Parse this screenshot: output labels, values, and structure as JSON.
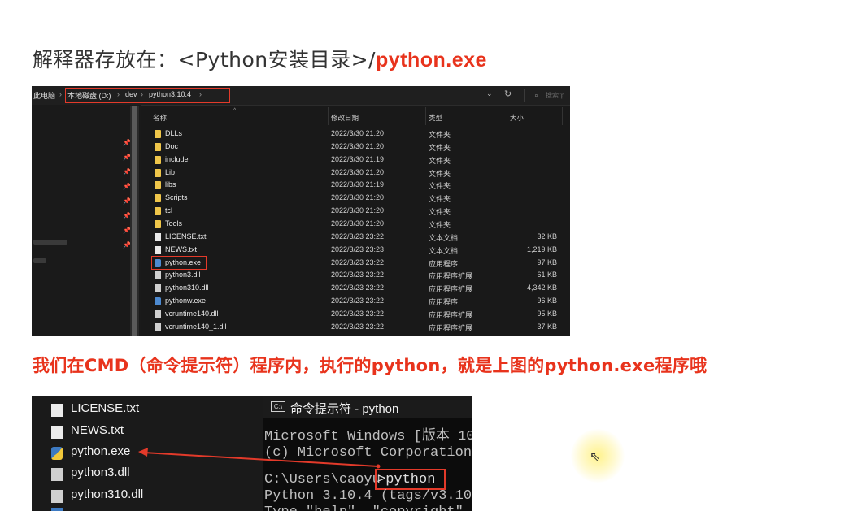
{
  "heading": {
    "prefix": "解释器存放在：<Python安装目录>/",
    "highlight": "python.exe"
  },
  "explorer": {
    "address": {
      "this_pc": "此电脑",
      "drive": "本地磁盘 (D:)",
      "folder1": "dev",
      "folder2": "python3.10.4",
      "search_placeholder": "搜索\"p"
    },
    "columns": {
      "name": "名称",
      "date": "修改日期",
      "type": "类型",
      "size": "大小"
    },
    "files": [
      {
        "name": "DLLs",
        "date": "2022/3/30 21:20",
        "type": "文件夹",
        "size": "",
        "icon": "folder-icon"
      },
      {
        "name": "Doc",
        "date": "2022/3/30 21:20",
        "type": "文件夹",
        "size": "",
        "icon": "folder-icon"
      },
      {
        "name": "include",
        "date": "2022/3/30 21:19",
        "type": "文件夹",
        "size": "",
        "icon": "folder-icon"
      },
      {
        "name": "Lib",
        "date": "2022/3/30 21:20",
        "type": "文件夹",
        "size": "",
        "icon": "folder-icon"
      },
      {
        "name": "libs",
        "date": "2022/3/30 21:19",
        "type": "文件夹",
        "size": "",
        "icon": "folder-icon"
      },
      {
        "name": "Scripts",
        "date": "2022/3/30 21:20",
        "type": "文件夹",
        "size": "",
        "icon": "folder-icon"
      },
      {
        "name": "tcl",
        "date": "2022/3/30 21:20",
        "type": "文件夹",
        "size": "",
        "icon": "folder-icon"
      },
      {
        "name": "Tools",
        "date": "2022/3/30 21:20",
        "type": "文件夹",
        "size": "",
        "icon": "folder-icon"
      },
      {
        "name": "LICENSE.txt",
        "date": "2022/3/23 23:22",
        "type": "文本文档",
        "size": "32 KB",
        "icon": "text-file-icon"
      },
      {
        "name": "NEWS.txt",
        "date": "2022/3/23 23:23",
        "type": "文本文档",
        "size": "1,219 KB",
        "icon": "text-file-icon"
      },
      {
        "name": "python.exe",
        "date": "2022/3/23 23:22",
        "type": "应用程序",
        "size": "97 KB",
        "icon": "python-exe-icon"
      },
      {
        "name": "python3.dll",
        "date": "2022/3/23 23:22",
        "type": "应用程序扩展",
        "size": "61 KB",
        "icon": "dll-icon"
      },
      {
        "name": "python310.dll",
        "date": "2022/3/23 23:22",
        "type": "应用程序扩展",
        "size": "4,342 KB",
        "icon": "dll-icon"
      },
      {
        "name": "pythonw.exe",
        "date": "2022/3/23 23:22",
        "type": "应用程序",
        "size": "96 KB",
        "icon": "python-exe-icon"
      },
      {
        "name": "vcruntime140.dll",
        "date": "2022/3/23 23:22",
        "type": "应用程序扩展",
        "size": "95 KB",
        "icon": "dll-icon"
      },
      {
        "name": "vcruntime140_1.dll",
        "date": "2022/3/23 23:22",
        "type": "应用程序扩展",
        "size": "37 KB",
        "icon": "dll-icon"
      }
    ]
  },
  "caption": "我们在CMD（命令提示符）程序内，执行的python，就是上图的python.exe程序哦",
  "bottom_files": [
    "LICENSE.txt",
    "NEWS.txt",
    "python.exe",
    "python3.dll",
    "python310.dll"
  ],
  "cmd": {
    "icon_text": "C:\\",
    "title": "命令提示符 - python",
    "lines": [
      "Microsoft Windows [版本 10",
      "(c) Microsoft Corporation。",
      "",
      "C:\\Users\\caoyu",
      ">python",
      "Python 3.10.4 (tags/v3.10.",
      "Type \"help\", \"copyright\""
    ]
  },
  "colors": {
    "highlight_red": "#e8331c",
    "box_red": "#e33a2a"
  }
}
